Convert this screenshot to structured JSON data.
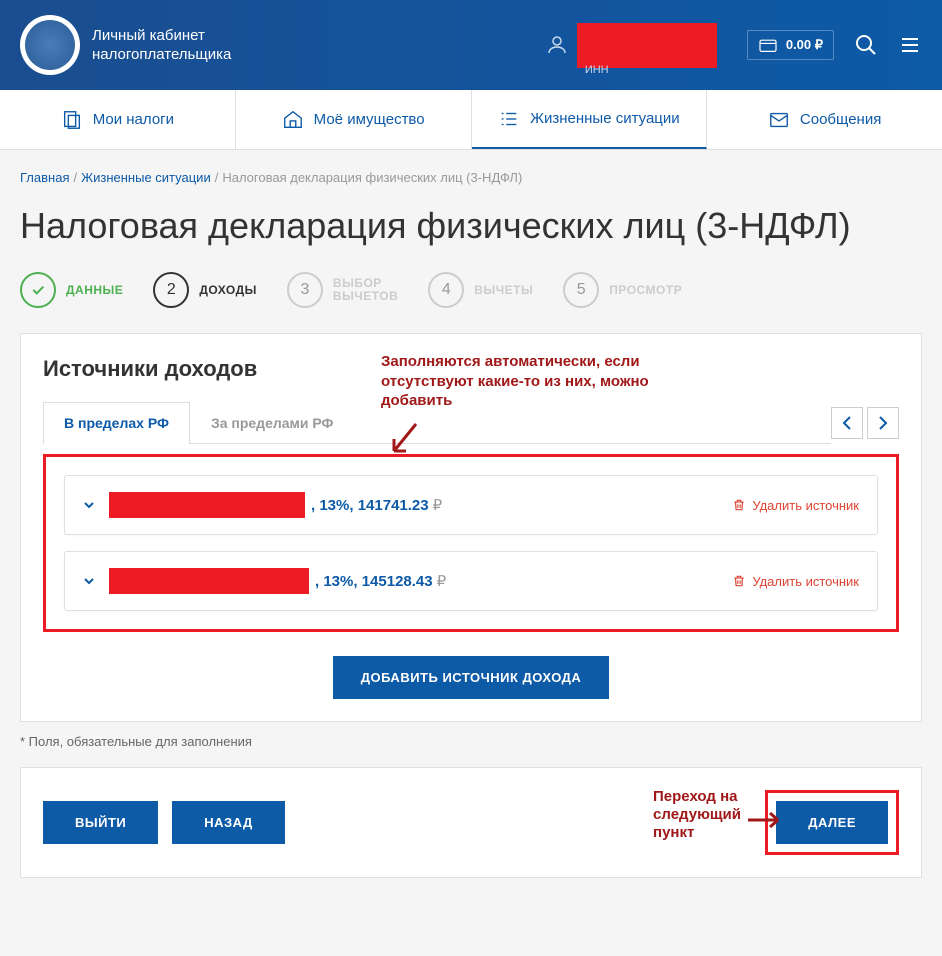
{
  "header": {
    "app_title_line1": "Личный кабинет",
    "app_title_line2": "налогоплательщика",
    "inn_label": "ИНН",
    "balance": "0.00 ₽"
  },
  "nav": {
    "tabs": [
      {
        "label": "Мои налоги"
      },
      {
        "label": "Моё имущество"
      },
      {
        "label": "Жизненные ситуации"
      },
      {
        "label": "Сообщения"
      }
    ]
  },
  "breadcrumb": {
    "home": "Главная",
    "section": "Жизненные ситуации",
    "current": "Налоговая декларация физических лиц (3-НДФЛ)"
  },
  "page_title": "Налоговая декларация физических лиц (3-НДФЛ)",
  "steps": [
    {
      "num": "✓",
      "label": "ДАННЫЕ"
    },
    {
      "num": "2",
      "label": "ДОХОДЫ"
    },
    {
      "num": "3",
      "label_line1": "ВЫБОР",
      "label_line2": "ВЫЧЕТОВ"
    },
    {
      "num": "4",
      "label": "ВЫЧЕТЫ"
    },
    {
      "num": "5",
      "label": "ПРОСМОТР"
    }
  ],
  "panel": {
    "title": "Источники доходов",
    "tabs": [
      {
        "label": "В пределах РФ"
      },
      {
        "label": "За пределами РФ"
      }
    ],
    "sources": [
      {
        "rate": ", 13%,",
        "amount": "141741.23",
        "redacted_width": 196,
        "delete": "Удалить источник"
      },
      {
        "rate": ", 13%,",
        "amount": "145128.43",
        "redacted_width": 200,
        "delete": "Удалить источник"
      }
    ],
    "add_button": "ДОБАВИТЬ ИСТОЧНИК ДОХОДА",
    "footnote": "* Поля, обязательные для заполнения"
  },
  "annotations": {
    "auto_fill": "Заполняются автоматически, если отсутствуют какие-то из них, можно добавить",
    "next_step": "Переход на следующий пункт"
  },
  "buttons": {
    "exit": "ВЫЙТИ",
    "back": "НАЗАД",
    "next": "ДАЛЕЕ"
  }
}
